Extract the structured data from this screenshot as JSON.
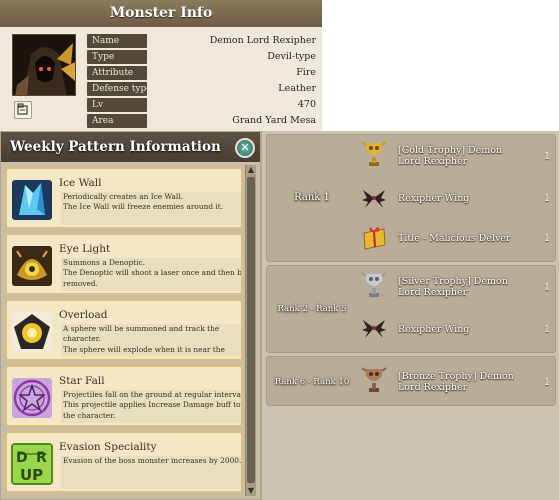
{
  "monster_info": {
    "title": "Monster Info",
    "fields": [
      {
        "label": "Name",
        "value": "Demon Lord Rexipher"
      },
      {
        "label": "Type",
        "value": "Devil-type"
      },
      {
        "label": "Attribute",
        "value": "Fire"
      },
      {
        "label": "Defense type",
        "value": "Leather"
      },
      {
        "label": "Lv",
        "value": "470"
      },
      {
        "label": "Area",
        "value": "Grand Yard Mesa"
      }
    ]
  },
  "weekly_pattern": {
    "title": "Weekly Pattern Information",
    "items": [
      {
        "name": "Ice Wall",
        "icon": "ice-wall-icon",
        "desc": [
          "Periodically creates an Ice Wall.",
          "The Ice Wall will freeze enemies around it."
        ]
      },
      {
        "name": "Eye Light",
        "icon": "eye-light-icon",
        "desc": [
          "Summons a Denoptic.",
          "The Denoptic will shoot a laser once and then be",
          "removed."
        ]
      },
      {
        "name": "Overload",
        "icon": "overload-icon",
        "desc": [
          "A sphere will be summoned and track the",
          "character.",
          "The sphere will explode when it is near the"
        ]
      },
      {
        "name": "Star Fall",
        "icon": "star-fall-icon",
        "desc": [
          "Projectiles fall on the ground at regular intervals.",
          "This projectile applies Increase Damage buff to",
          "the character."
        ]
      },
      {
        "name": "Evasion Speciality",
        "icon": "evasion-speciality-icon",
        "icon_text": [
          "D",
          "R",
          "UP"
        ],
        "desc": [
          "Evasion of the boss monster increases by 2000."
        ]
      }
    ]
  },
  "rewards": [
    {
      "rank": "Rank 1",
      "items": [
        {
          "name": [
            "[Gold Trophy] Demon",
            "Lord Rexipher"
          ],
          "qty": "1",
          "icon": "gold-trophy-icon"
        },
        {
          "name": [
            "Rexipher Wing"
          ],
          "qty": "1",
          "icon": "wing-icon"
        },
        {
          "name": [
            "Title - Malicious Delver"
          ],
          "qty": "1",
          "icon": "title-gift-icon"
        }
      ]
    },
    {
      "rank": "Rank 2 - Rank 5",
      "items": [
        {
          "name": [
            "[Silver Trophy] Demon",
            "Lord Rexipher"
          ],
          "qty": "1",
          "icon": "silver-trophy-icon"
        },
        {
          "name": [
            "Rexipher Wing"
          ],
          "qty": "1",
          "icon": "wing-icon"
        }
      ]
    },
    {
      "rank": "Rank 6 - Rank 10",
      "items": [
        {
          "name": [
            "[Bronze Trophy] Demon",
            "Lord Rexipher"
          ],
          "qty": "1",
          "icon": "bronze-trophy-icon"
        }
      ]
    }
  ],
  "colors": {
    "gold": "#e0b23a",
    "silver": "#b9bcc4",
    "bronze": "#b07a5a",
    "accent_teal": "#2f6e64"
  }
}
